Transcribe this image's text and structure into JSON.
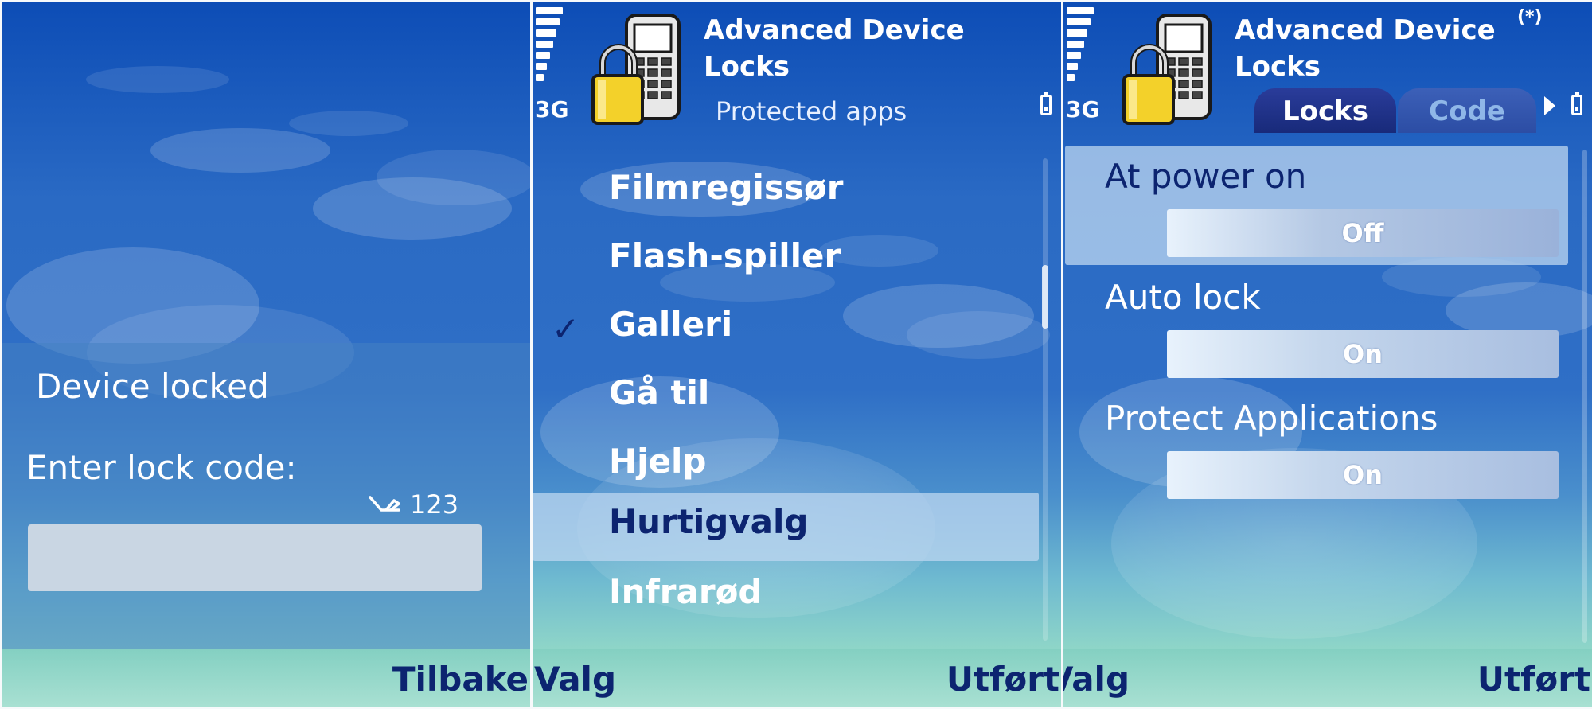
{
  "lock_screen": {
    "title": "Device locked",
    "prompt": "Enter lock code:",
    "input_mode": "123",
    "input_value": "",
    "softkey_right": "Tilbake"
  },
  "protected_apps": {
    "status": {
      "network": "3G"
    },
    "app_title_line1": "Advanced Device",
    "app_title_line2": "Locks",
    "subtitle": "Protected apps",
    "items": [
      {
        "label": "Filmregissør",
        "checked": false
      },
      {
        "label": "Flash-spiller",
        "checked": false
      },
      {
        "label": "Galleri",
        "checked": true
      },
      {
        "label": "Gå til",
        "checked": false
      },
      {
        "label": "Hjelp",
        "checked": false
      },
      {
        "label": "Hurtigvalg",
        "checked": false
      },
      {
        "label": "Infrarød",
        "checked": false
      }
    ],
    "checkmark": "✓",
    "softkey_left": "Valg",
    "softkey_right": "Utført"
  },
  "settings": {
    "status": {
      "network": "3G",
      "bluetooth": "(*)"
    },
    "app_title_line1": "Advanced Device",
    "app_title_line2": "Locks",
    "tabs": [
      "Locks",
      "Code"
    ],
    "active_tab": "Locks",
    "items": [
      {
        "label": "At power on",
        "value": "Off"
      },
      {
        "label": "Auto lock",
        "value": "On"
      },
      {
        "label": "Protect Applications",
        "value": "On"
      }
    ],
    "softkey_left": "Valg",
    "softkey_right": "Utført"
  },
  "colors": {
    "text_dark": "#0c2470",
    "highlight": "#bed7f0",
    "background_top": "#0d4db6",
    "softkey_bar": "#9ad9cc"
  }
}
